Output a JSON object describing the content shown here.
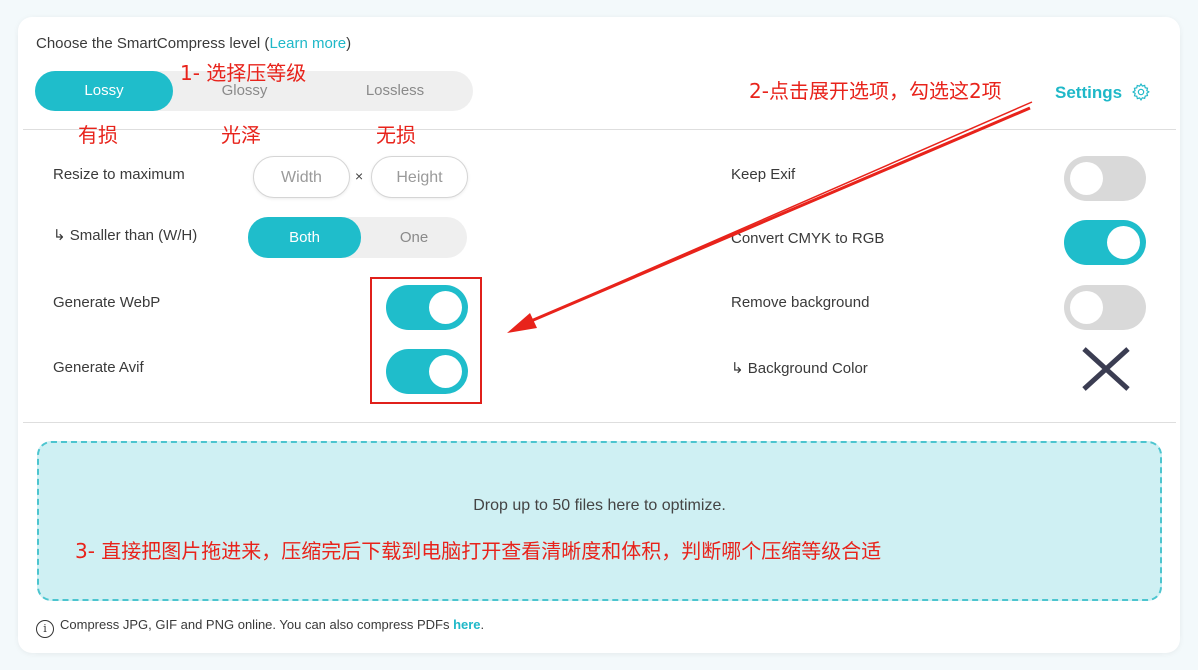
{
  "header": {
    "title_prefix": "Choose the SmartCompress level (",
    "learn_more": "Learn more",
    "title_suffix": ")",
    "settings_label": "Settings"
  },
  "levels": [
    {
      "label": "Lossy",
      "active": true
    },
    {
      "label": "Glossy",
      "active": false
    },
    {
      "label": "Lossless",
      "active": false
    }
  ],
  "options_left": {
    "resize_label": "Resize to maximum",
    "width_placeholder": "Width",
    "times": "×",
    "height_placeholder": "Height",
    "smaller_label": "↳ Smaller than (W/H)",
    "both_label": "Both",
    "one_label": "One",
    "webp_label": "Generate WebP",
    "webp_on": true,
    "avif_label": "Generate Avif",
    "avif_on": true
  },
  "options_right": {
    "exif_label": "Keep Exif",
    "exif_on": false,
    "cmyk_label": "Convert CMYK to RGB",
    "cmyk_on": true,
    "remove_bg_label": "Remove background",
    "remove_bg_on": false,
    "bg_color_label": "↳ Background Color"
  },
  "dropzone": {
    "text": "Drop up to 50 files here to optimize."
  },
  "footer": {
    "text": "Compress JPG, GIF and PNG online. You can also compress PDFs ",
    "link": "here",
    "end": "."
  },
  "annotations": {
    "step1": "1- 选择压等级",
    "lossy_cn": "有损",
    "glossy_cn": "光泽",
    "lossless_cn": "无损",
    "step2": "2-点击展开选项，勾选这2项",
    "step3": "3- 直接把图片拖进来，压缩完后下载到电脑打开查看清晰度和体积，判断哪个压缩等级合适"
  },
  "colors": {
    "accent": "#1fbdcb",
    "annotation_red": "#e8231b",
    "dropzone_bg": "#cff0f3"
  }
}
